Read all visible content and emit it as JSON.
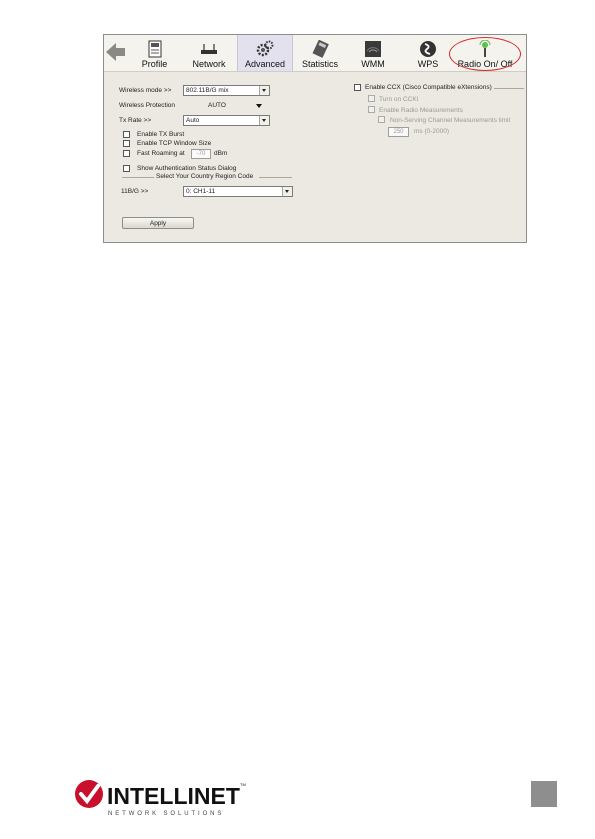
{
  "toolbar": {
    "items": [
      {
        "label": "Profile",
        "icon": "profile-icon"
      },
      {
        "label": "Network",
        "icon": "router-icon"
      },
      {
        "label": "Advanced",
        "icon": "gears-icon"
      },
      {
        "label": "Statistics",
        "icon": "calculator-icon"
      },
      {
        "label": "WMM",
        "icon": "wmm-icon"
      },
      {
        "label": "WPS",
        "icon": "wps-icon"
      },
      {
        "label": "Radio On/ Off",
        "icon": "antenna-icon"
      }
    ],
    "active": "Advanced",
    "highlight_color": "#d62b2b"
  },
  "settings": {
    "wireless_mode_label": "Wireless mode >>",
    "wireless_mode_value": "802.11B/G mix",
    "wireless_protection_label": "Wireless Protection",
    "wireless_protection_value": "AUTO",
    "tx_rate_label": "Tx Rate >>",
    "tx_rate_value": "Auto",
    "enable_tx_burst": "Enable TX Burst",
    "enable_tcp_window": "Enable TCP Window Size",
    "fast_roaming": "Fast Roaming at",
    "fast_roaming_value": "-70",
    "fast_roaming_unit": "dBm",
    "show_auth_dialog": "Show Authentication Status Dialog",
    "region_caption": "Select Your Country Region Code",
    "region_label": "11B/G >>",
    "region_value": "0: CH1-11",
    "apply_label": "Apply"
  },
  "ccx": {
    "enable_label": "Enable CCX (Cisco Compatible eXtensions)",
    "turn_on_ccki": "Turn on CCKI",
    "enable_radio_measurements": "Enable Radio Measurements",
    "non_serving_label": "Non-Serving Channel Measurements limit",
    "limit_value": "250",
    "limit_unit": "ms (0-2000)"
  },
  "footer": {
    "brand": "INTELLINET",
    "tagline": "NETWORK SOLUTIONS",
    "trademark": "TM",
    "brand_color": "#c8102e"
  }
}
